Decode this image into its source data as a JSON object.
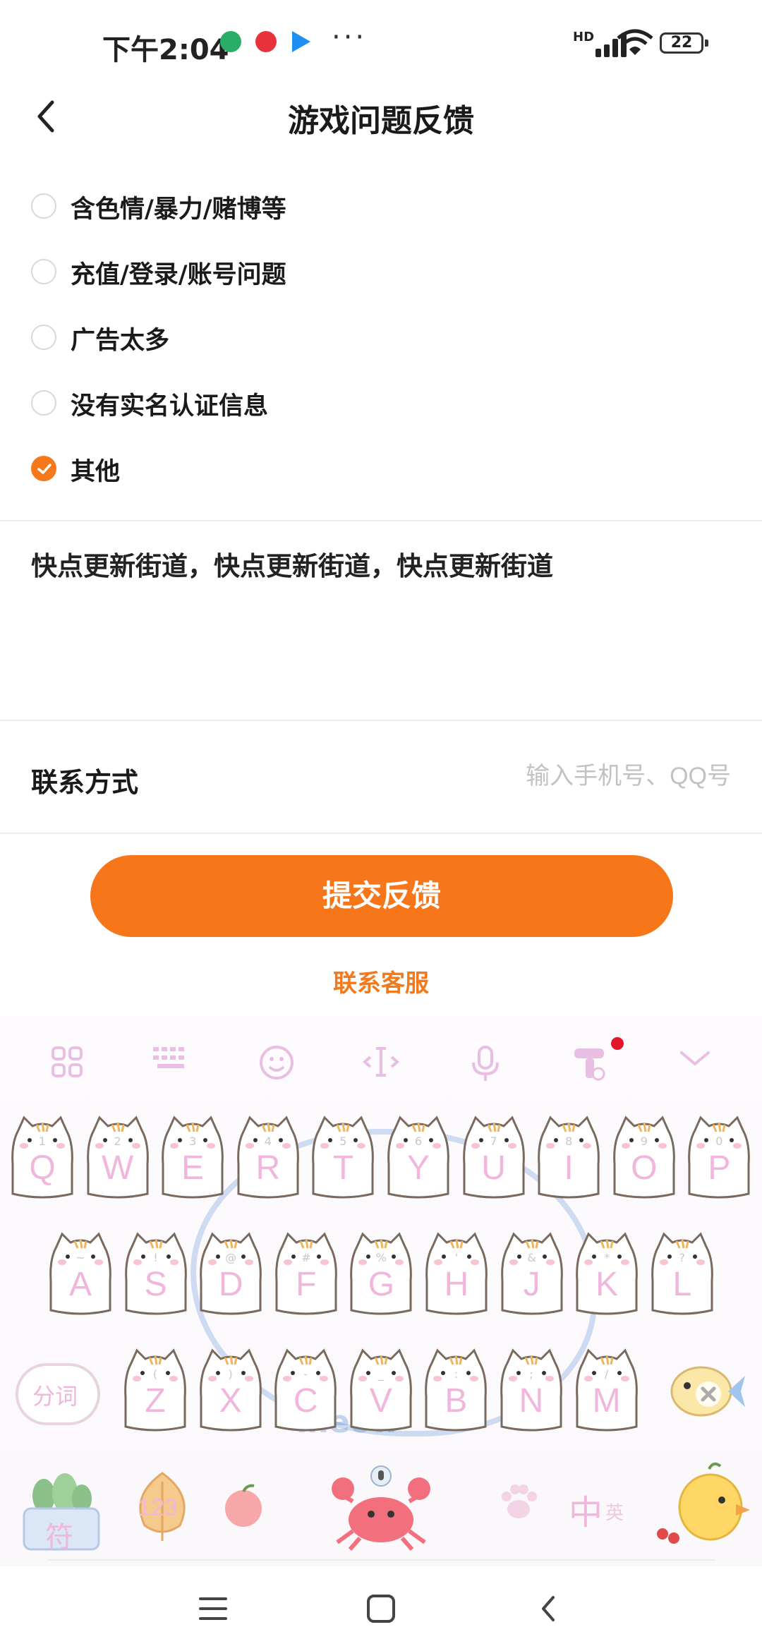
{
  "status_bar": {
    "time": "下午2:04",
    "network": "HD",
    "battery": "22",
    "more": "···",
    "icons": [
      "wechat-icon",
      "video-app-icon",
      "play-app-icon",
      "signal-icon",
      "wifi-icon",
      "battery-icon"
    ]
  },
  "header": {
    "title": "游戏问题反馈",
    "back_icon": "chevron-left-icon"
  },
  "options": [
    {
      "label": "含色情/暴力/赌博等",
      "checked": false
    },
    {
      "label": "充值/登录/账号问题",
      "checked": false
    },
    {
      "label": "广告太多",
      "checked": false
    },
    {
      "label": "没有实名认证信息",
      "checked": false
    },
    {
      "label": "其他",
      "checked": true
    }
  ],
  "feedback": {
    "text": "快点更新街道，快点更新街道，快点更新街道"
  },
  "contact": {
    "label": "联系方式",
    "value": "",
    "placeholder": "输入手机号、QQ号"
  },
  "submit": {
    "label": "提交反馈"
  },
  "customer_service": {
    "label": "联系客服"
  },
  "keyboard": {
    "toolbar": [
      "grid-icon",
      "keyboard-icon",
      "emoji-icon",
      "cursor-icon",
      "microphone-icon",
      "skin-icon",
      "chevron-down-icon"
    ],
    "rows": [
      [
        {
          "k": "Q",
          "n": "1"
        },
        {
          "k": "W",
          "n": "2"
        },
        {
          "k": "E",
          "n": "3"
        },
        {
          "k": "R",
          "n": "4"
        },
        {
          "k": "T",
          "n": "5"
        },
        {
          "k": "Y",
          "n": "6"
        },
        {
          "k": "U",
          "n": "7"
        },
        {
          "k": "I",
          "n": "8"
        },
        {
          "k": "O",
          "n": "9"
        },
        {
          "k": "P",
          "n": "0"
        }
      ],
      [
        {
          "k": "A",
          "n": "~"
        },
        {
          "k": "S",
          "n": "!"
        },
        {
          "k": "D",
          "n": "@"
        },
        {
          "k": "F",
          "n": "#"
        },
        {
          "k": "G",
          "n": "%"
        },
        {
          "k": "H",
          "n": "'"
        },
        {
          "k": "J",
          "n": "&"
        },
        {
          "k": "K",
          "n": "*"
        },
        {
          "k": "L",
          "n": "?"
        }
      ],
      [
        {
          "k": "Z",
          "n": "("
        },
        {
          "k": "X",
          "n": ")"
        },
        {
          "k": "C",
          "n": "-"
        },
        {
          "k": "V",
          "n": "_"
        },
        {
          "k": "B",
          "n": ":"
        },
        {
          "k": "N",
          "n": ";"
        },
        {
          "k": "M",
          "n": "/"
        }
      ]
    ],
    "split_label": "分词",
    "symbol_label": "符",
    "number_label": "123",
    "lang_main": "中",
    "lang_sub": "英",
    "deco_text": "meow",
    "colors": {
      "key_letter": "#f0b6dc",
      "accent": "#f5791b"
    }
  },
  "nav_bar": {
    "icons": [
      "menu-icon",
      "home-icon",
      "back-icon"
    ]
  }
}
